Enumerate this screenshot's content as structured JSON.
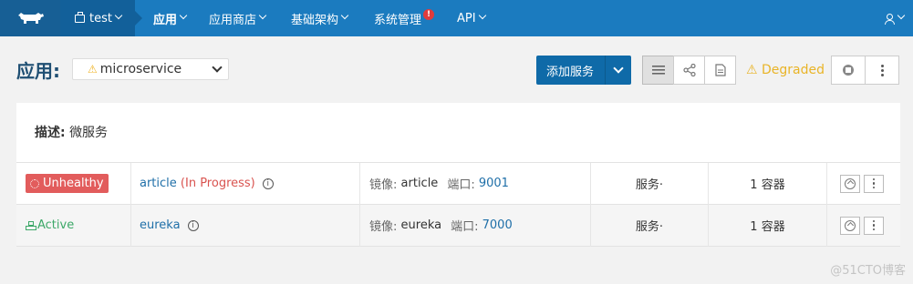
{
  "nav": {
    "environment": "test",
    "items": [
      {
        "label": "应用",
        "active": true
      },
      {
        "label": "应用商店"
      },
      {
        "label": "基础架构"
      },
      {
        "label": "系统管理",
        "alert": "!"
      },
      {
        "label": "API"
      }
    ]
  },
  "header": {
    "title": "应用:",
    "stack_name": "microservice",
    "add_service_label": "添加服务",
    "state_label": "Degraded"
  },
  "description": {
    "key": "描述:",
    "value": "微服务"
  },
  "services": [
    {
      "state": "Unhealthy",
      "name": "article",
      "progress": "(In Progress)",
      "image_label": "镜像:",
      "image": "article",
      "port_label": "端口:",
      "port": "9001",
      "type": "服务·",
      "containers": "1 容器"
    },
    {
      "state": "Active",
      "name": "eureka",
      "image_label": "镜像:",
      "image": "eureka",
      "port_label": "端口:",
      "port": "7000",
      "type": "服务·",
      "containers": "1 容器"
    }
  ],
  "watermark": "@51CTO博客",
  "colors": {
    "nav_bg": "#1b7bbf",
    "primary": "#0f6aa8",
    "degraded": "#e9b427",
    "unhealthy": "#e25c5c",
    "active": "#3da868"
  }
}
